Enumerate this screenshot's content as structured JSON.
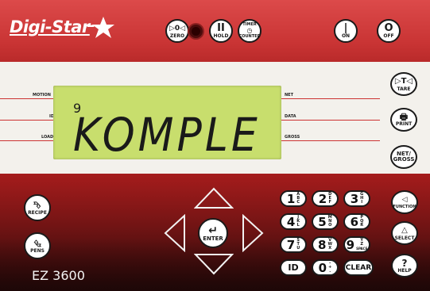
{
  "brand": {
    "name": "Digi-Star"
  },
  "top_buttons": {
    "zero": {
      "symbol": "▷0◁",
      "label": "ZERO"
    },
    "hold": {
      "symbol": "II",
      "label": "HOLD"
    },
    "timer_counter": {
      "line1": "TIMER",
      "label": "COUNTER"
    },
    "on": {
      "symbol": "|",
      "label": "ON"
    },
    "off": {
      "symbol": "O",
      "label": "OFF"
    }
  },
  "indicators_left": {
    "motion": "MOTION",
    "id": "ID",
    "load": "LOAD"
  },
  "indicators_right": {
    "net": "NET",
    "data": "DATA",
    "gross": "GROSS"
  },
  "display": {
    "small": "9",
    "main": "KOMPLE"
  },
  "side_buttons": {
    "tare": {
      "symbol": "▷T◁",
      "label": "TARE"
    },
    "print": {
      "label": "PRINT"
    },
    "net_gross": {
      "line1": "NET/",
      "line2": "GROSS"
    }
  },
  "bottom_left": {
    "recipe": {
      "label": "RECIPE"
    },
    "pens": {
      "label": "PENS"
    },
    "model": "EZ 3600"
  },
  "nav": {
    "enter": "ENTER"
  },
  "keypad": [
    {
      "digit": "1",
      "sub": [
        "A",
        "B",
        "C"
      ]
    },
    {
      "digit": "2",
      "sub": [
        "D",
        "E",
        "F"
      ]
    },
    {
      "digit": "3",
      "sub": [
        "G",
        "H",
        "I"
      ]
    },
    {
      "digit": "4",
      "sub": [
        "J",
        "K",
        "L"
      ]
    },
    {
      "digit": "5",
      "sub": [
        "M",
        "N",
        "O"
      ]
    },
    {
      "digit": "6",
      "sub": [
        "P",
        "Q",
        "R"
      ]
    },
    {
      "digit": "7",
      "sub": [
        "S",
        "T",
        "U"
      ]
    },
    {
      "digit": "8",
      "sub": [
        "V",
        "W",
        "X"
      ]
    },
    {
      "digit": "9",
      "sub": [
        "Y",
        "Z",
        "SPACE"
      ]
    },
    {
      "digit": "ID",
      "sub": []
    },
    {
      "digit": "0",
      "sub": [
        "-",
        "+",
        "."
      ]
    },
    {
      "digit": "CLEAR",
      "sub": []
    }
  ],
  "right_keys": {
    "function": {
      "symbol": "◁",
      "label": "FUNCTION"
    },
    "select": {
      "symbol": "△",
      "label": "SELECT"
    },
    "help": {
      "symbol": "?",
      "label": "HELP"
    }
  }
}
